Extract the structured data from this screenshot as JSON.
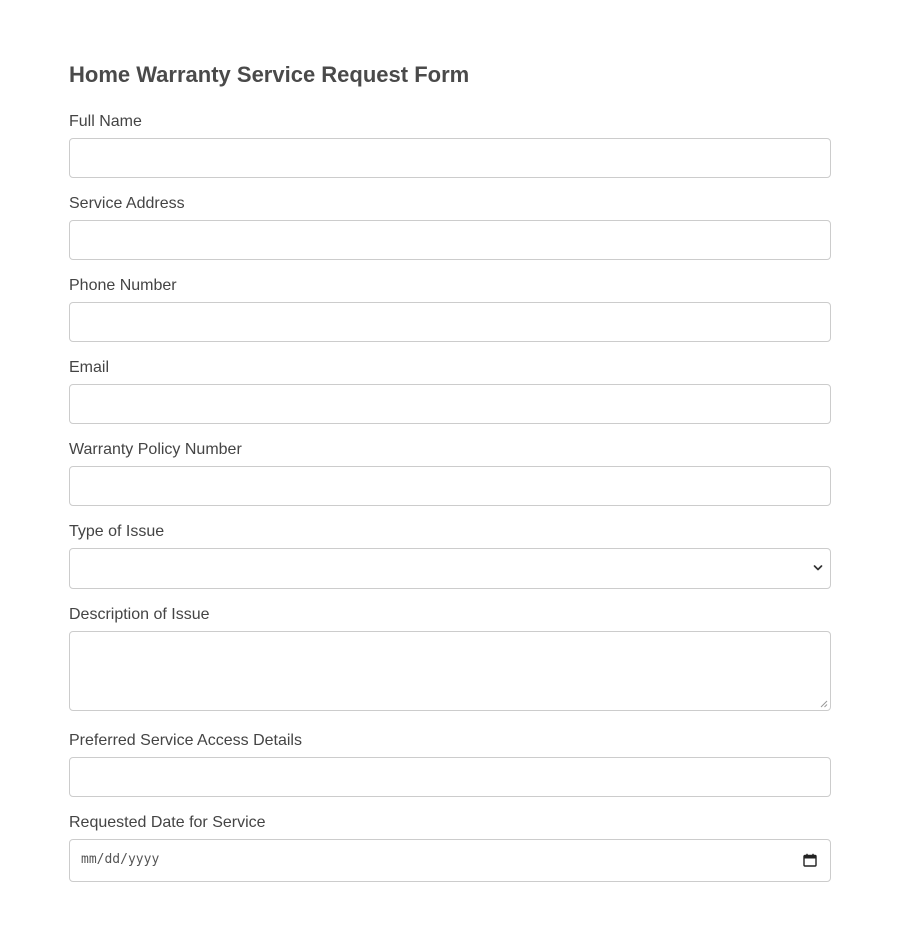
{
  "form": {
    "title": "Home Warranty Service Request Form",
    "fields": {
      "full_name": {
        "label": "Full Name",
        "value": ""
      },
      "service_address": {
        "label": "Service Address",
        "value": ""
      },
      "phone_number": {
        "label": "Phone Number",
        "value": ""
      },
      "email": {
        "label": "Email",
        "value": ""
      },
      "policy_number": {
        "label": "Warranty Policy Number",
        "value": ""
      },
      "issue_type": {
        "label": "Type of Issue",
        "selected": "",
        "icon": "chevron-down-icon"
      },
      "issue_description": {
        "label": "Description of Issue",
        "value": ""
      },
      "access_details": {
        "label": "Preferred Service Access Details",
        "value": ""
      },
      "requested_date": {
        "label": "Requested Date for Service",
        "placeholder": "mm/dd/yyyy",
        "icon": "calendar-icon"
      }
    }
  },
  "colors": {
    "text": "#444444",
    "border": "#cccccc",
    "background": "#ffffff"
  }
}
